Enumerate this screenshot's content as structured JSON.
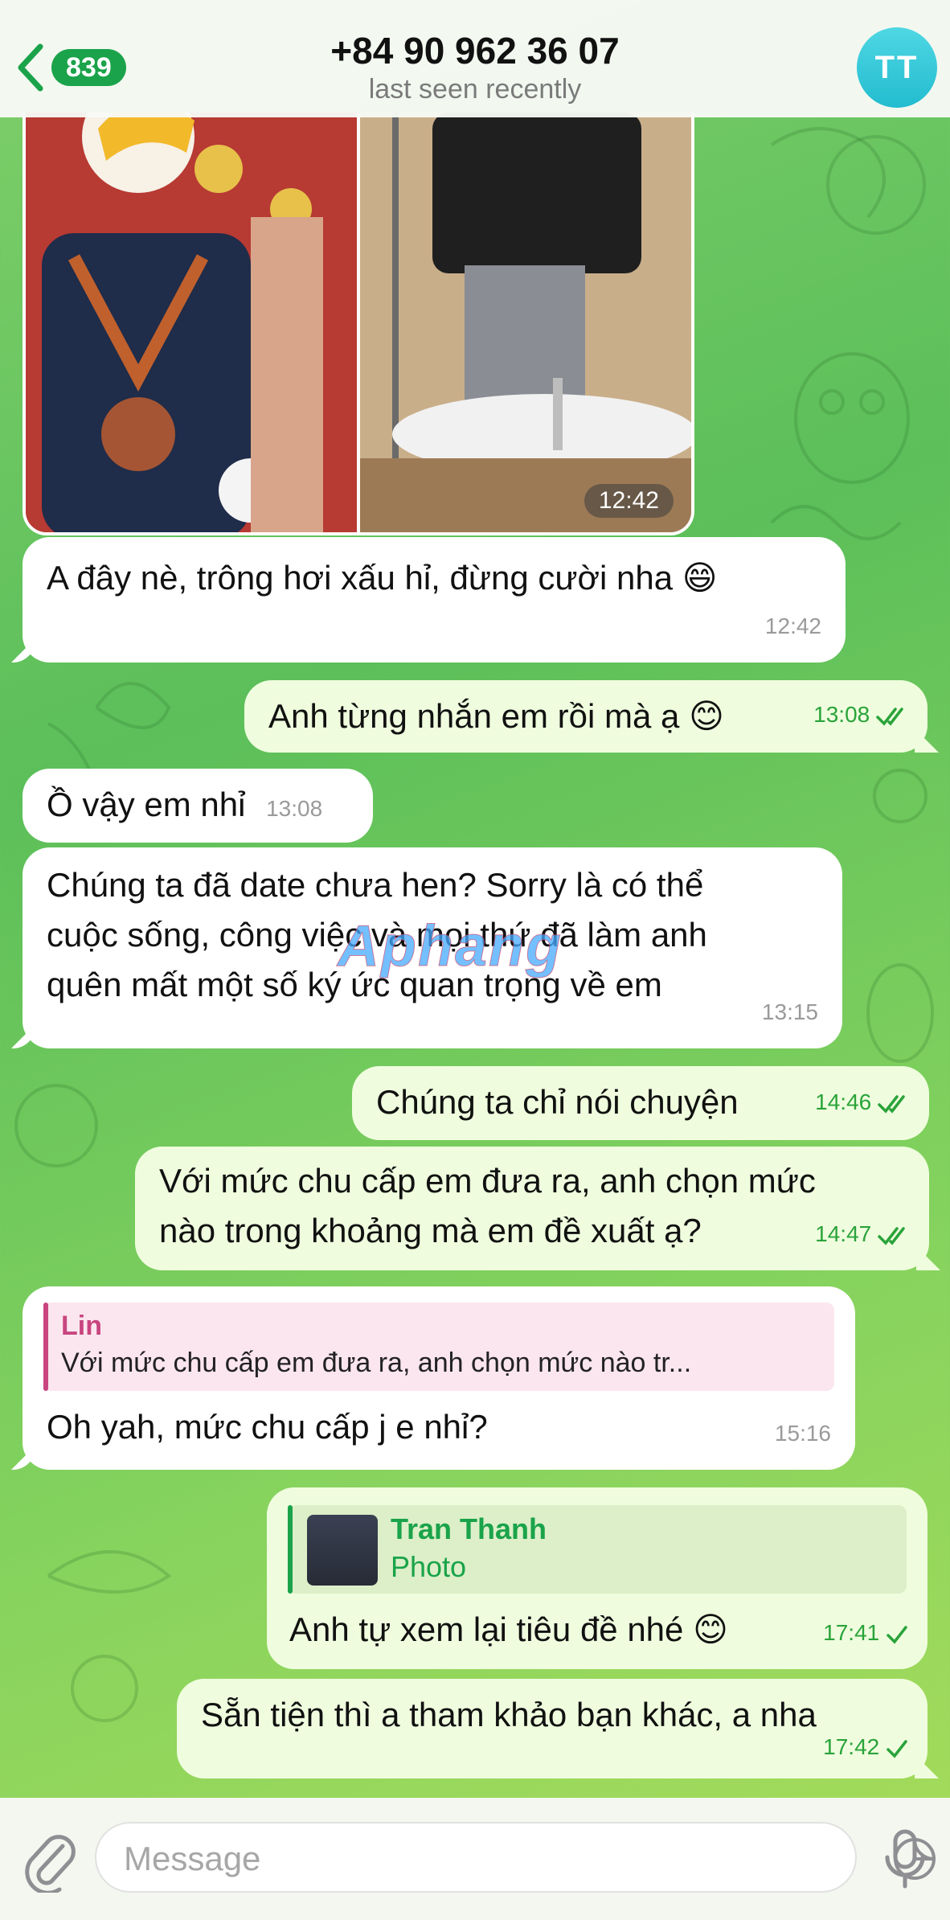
{
  "colors": {
    "accent": "#1aa34a",
    "incoming_bubble": "#ffffff",
    "outgoing_bubble": "#effdde",
    "time_outgoing": "#2aa33a",
    "time_incoming": "#9a9a9a",
    "reply_pink": "#c8457f",
    "reply_green": "#1aa34a"
  },
  "header": {
    "back_count": "839",
    "title": "+84 90 962 36 07",
    "status": "last seen recently",
    "avatar_initials": "TT"
  },
  "album": {
    "time": "12:42"
  },
  "watermark": "Aphang",
  "messages": [
    {
      "id": "m1",
      "dir": "in",
      "text": "A đây nè, trông hơi xấu hỉ, đừng cười nha 😄",
      "text_line2": "😄",
      "time": "12:42"
    },
    {
      "id": "m2",
      "dir": "out",
      "text": "Anh từng nhắn em rồi mà ạ 😊",
      "time": "13:08",
      "status": "read"
    },
    {
      "id": "m3",
      "dir": "in",
      "text": "Ồ vậy em nhỉ",
      "time": "13:08"
    },
    {
      "id": "m4",
      "dir": "in",
      "lines": [
        "Chúng ta đã date chưa hen? Sorry là có thể",
        "cuộc sống, công việc và mọi thứ đã làm anh",
        "quên mất một số ký ức quan trọng về em"
      ],
      "time": "13:15"
    },
    {
      "id": "m5",
      "dir": "out",
      "text": "Chúng ta chỉ nói chuyện",
      "time": "14:46",
      "status": "read"
    },
    {
      "id": "m6",
      "dir": "out",
      "lines": [
        "Với mức chu cấp em đưa ra, anh chọn mức",
        "nào trong khoảng mà em đề xuất ạ?"
      ],
      "time": "14:47",
      "status": "read"
    },
    {
      "id": "m7",
      "dir": "in",
      "reply_name": "Lin",
      "reply_text": "Với mức chu cấp em đưa ra, anh chọn mức nào tr...",
      "text": "Oh yah, mức chu cấp j e nhỉ?",
      "time": "15:16"
    },
    {
      "id": "m8",
      "dir": "out",
      "reply_name": "Tran Thanh",
      "reply_text": "Photo",
      "text": "Anh tự xem lại tiêu đề nhé 😊",
      "time": "17:41",
      "status": "sent"
    },
    {
      "id": "m9",
      "dir": "out",
      "text": "Sẵn tiện thì a tham khảo bạn khác, a nha",
      "time": "17:42",
      "status": "sent"
    }
  ],
  "input": {
    "placeholder": "Message"
  },
  "icons": {
    "back": "chevron-left-icon",
    "attach": "paperclip-icon",
    "sticker": "sticker-icon",
    "mic": "microphone-icon",
    "read": "double-check-icon",
    "sent": "single-check-icon"
  }
}
